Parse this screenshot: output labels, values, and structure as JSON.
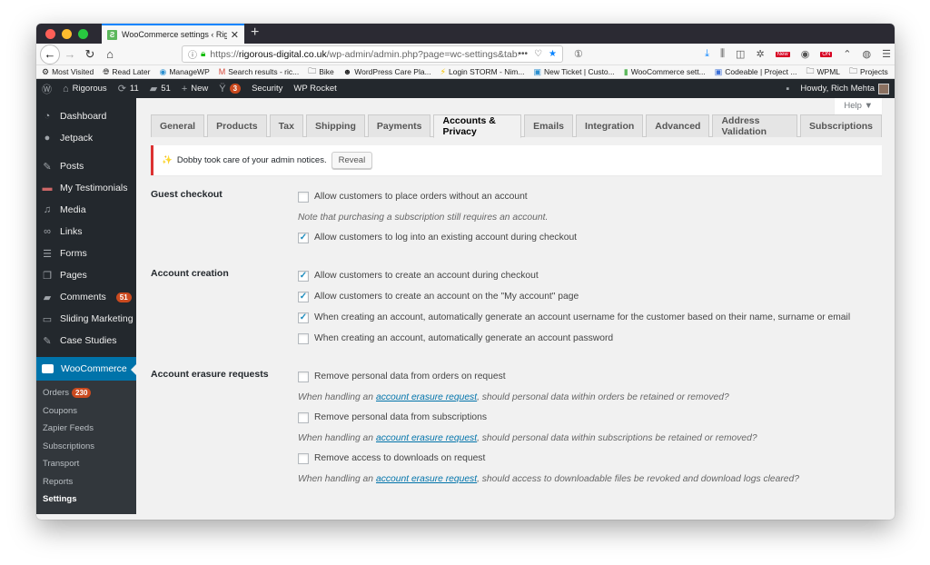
{
  "browser": {
    "tab_title": "WooCommerce settings ‹ Rigor",
    "tab_favicon": "woocommerce-favicon",
    "new_tab": "+",
    "url_prefix": "https://",
    "url_domain": "rigorous-digital.co.uk",
    "url_path": "/wp-admin/admin.php?page=wc-settings&tab=ac",
    "url_actions": [
      "•••",
      "pocket-icon",
      "star-icon"
    ],
    "toolbar_badges": {
      "new": "New",
      "on": "ON"
    },
    "bookmarks": [
      {
        "label": "Most Visited",
        "icon": "gear-icon"
      },
      {
        "label": "Read Later",
        "icon": "globe-icon"
      },
      {
        "label": "ManageWP",
        "icon": "managewp-icon"
      },
      {
        "label": "Search results - ric...",
        "icon": "gmail-icon"
      },
      {
        "label": "Bike",
        "icon": "folder-icon"
      },
      {
        "label": "WordPress Care Pla...",
        "icon": "avatar-icon"
      },
      {
        "label": "Login STORM - Nim...",
        "icon": "lightning-icon"
      },
      {
        "label": "New Ticket | Custo...",
        "icon": "ticket-icon"
      },
      {
        "label": "WooCommerce sett...",
        "icon": "woocommerce-icon"
      },
      {
        "label": "Codeable | Project ...",
        "icon": "codeable-icon"
      },
      {
        "label": "WPML",
        "icon": "folder-icon"
      },
      {
        "label": "Projects",
        "icon": "folder-icon"
      }
    ]
  },
  "adminbar": {
    "site_name": "Rigorous",
    "updates": "11",
    "comments": "51",
    "new_label": "New",
    "yoast_count": "3",
    "security": "Security",
    "wp_rocket": "WP Rocket",
    "howdy": "Howdy, Rich Mehta"
  },
  "sidebar": {
    "items": [
      {
        "label": "Dashboard",
        "icon": "dashboard-icon"
      },
      {
        "label": "Jetpack",
        "icon": "jetpack-icon"
      },
      {
        "label": "Posts",
        "icon": "pin-icon"
      },
      {
        "label": "My Testimonials",
        "icon": "testimonials-icon"
      },
      {
        "label": "Media",
        "icon": "media-icon"
      },
      {
        "label": "Links",
        "icon": "link-icon"
      },
      {
        "label": "Forms",
        "icon": "forms-icon"
      },
      {
        "label": "Pages",
        "icon": "pages-icon"
      },
      {
        "label": "Comments",
        "icon": "comment-icon",
        "badge": "51"
      },
      {
        "label": "Sliding Marketing",
        "icon": "slider-icon"
      },
      {
        "label": "Case Studies",
        "icon": "pin-icon"
      }
    ],
    "current": {
      "label": "WooCommerce",
      "icon_text": "woo"
    },
    "submenu": [
      {
        "label": "Orders",
        "badge": "230"
      },
      {
        "label": "Coupons"
      },
      {
        "label": "Zapier Feeds"
      },
      {
        "label": "Subscriptions"
      },
      {
        "label": "Transport"
      },
      {
        "label": "Reports"
      },
      {
        "label": "Settings",
        "current": true
      }
    ]
  },
  "content": {
    "help_label": "Help ▼",
    "tabs": [
      {
        "label": "General"
      },
      {
        "label": "Products"
      },
      {
        "label": "Tax"
      },
      {
        "label": "Shipping"
      },
      {
        "label": "Payments"
      },
      {
        "label": "Accounts & Privacy",
        "active": true
      },
      {
        "label": "Emails"
      },
      {
        "label": "Integration"
      },
      {
        "label": "Advanced"
      },
      {
        "label": "Address Validation"
      },
      {
        "label": "Subscriptions"
      }
    ],
    "notice": {
      "icon": "✨",
      "text": "Dobby took care of your admin notices.",
      "button": "Reveal"
    },
    "sections": {
      "guest": {
        "label": "Guest checkout",
        "opt1": "Allow customers to place orders without an account",
        "opt1_checked": false,
        "note": "Note that purchasing a subscription still requires an account.",
        "opt2": "Allow customers to log into an existing account during checkout",
        "opt2_checked": true
      },
      "creation": {
        "label": "Account creation",
        "opt1": "Allow customers to create an account during checkout",
        "opt1_checked": true,
        "opt2": "Allow customers to create an account on the \"My account\" page",
        "opt2_checked": true,
        "opt3": "When creating an account, automatically generate an account username for the customer based on their name, surname or email",
        "opt3_checked": true,
        "opt4": "When creating an account, automatically generate an account password",
        "opt4_checked": false
      },
      "erasure": {
        "label": "Account erasure requests",
        "link": "account erasure request",
        "desc_prefix": "When handling an",
        "opt1": "Remove personal data from orders on request",
        "opt1_checked": false,
        "desc1_suffix": ", should personal data within orders be retained or removed?",
        "opt2": "Remove personal data from subscriptions",
        "opt2_checked": false,
        "desc2_suffix": ", should personal data within subscriptions be retained or removed?",
        "opt3": "Remove access to downloads on request",
        "opt3_checked": false,
        "desc3_suffix": ", should access to downloadable files be revoked and download logs cleared?"
      }
    }
  },
  "colors": {
    "wp_blue": "#0073aa",
    "admin_dark": "#23282d",
    "notice_red": "#dc3232",
    "badge_orange": "#ca4a1f",
    "firefox_blue": "#0a84ff"
  }
}
